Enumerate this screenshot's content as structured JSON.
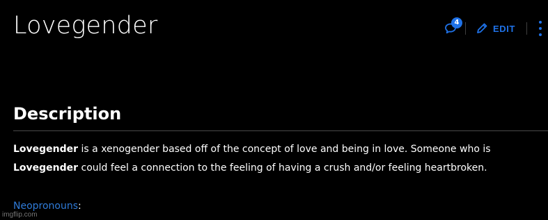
{
  "page": {
    "title": "Lovegender"
  },
  "toolbar": {
    "comment_count": "4",
    "edit_label": "EDIT",
    "accent_color": "#1f72e8",
    "icons": [
      "comment-icon",
      "pencil-icon",
      "more-vertical-icon"
    ]
  },
  "description": {
    "heading": "Description",
    "line1_bold": "Lovegender",
    "line1_text": " is a xenogender based off of the concept of love and being in love. Someone who is",
    "line2_bold": "Lovegender",
    "line2_text": " could feel a connection to the feeling of having a crush and/or feeling heartbroken."
  },
  "neopronouns": {
    "link": "Neopronouns",
    "suffix": ":"
  },
  "watermark": "imgflip.com"
}
